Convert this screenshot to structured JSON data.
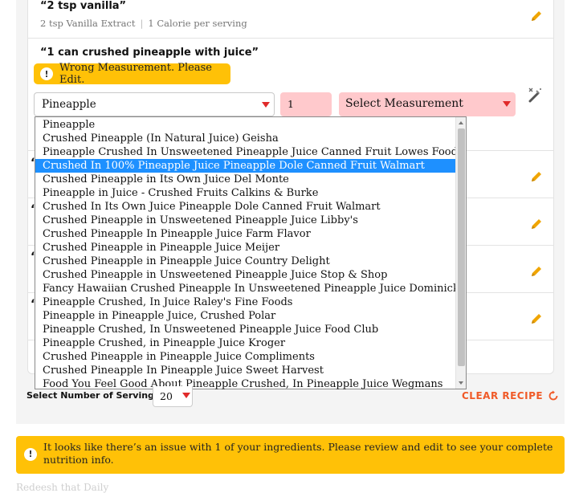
{
  "ingredients": [
    {
      "title": "“2 tsp vanilla”",
      "detail": "2 tsp Vanilla Extract",
      "calories": "1 Calorie per serving"
    },
    {
      "title": "“1 can crushed pineapple with juice”",
      "warning": "Wrong Measurement. Please Edit."
    }
  ],
  "editor": {
    "selected_food": "Pineapple",
    "quantity": "1",
    "measurement_placeholder": "Select Measurement"
  },
  "dropdown_options": [
    "Pineapple",
    "Crushed Pineapple (In Natural Juice) Geisha",
    "Pineapple Crushed In Unsweetened Pineapple Juice Canned Fruit Lowes Foods",
    "Crushed In 100% Pineapple Juice Pineapple Dole Canned Fruit Walmart",
    "Crushed Pineapple in Its Own Juice Del Monte",
    "Pineapple in Juice - Crushed Fruits Calkins & Burke",
    "Crushed In Its Own Juice Pineapple Dole Canned Fruit Walmart",
    "Crushed Pineapple in Unsweetened Pineapple Juice Libby's",
    "Crushed Pineapple In Pineapple Juice Farm Flavor",
    "Crushed Pineapple in Pineapple Juice Meijer",
    "Crushed Pineapple in Pineapple Juice Country Delight",
    "Crushed Pineapple in Unsweetened Pineapple Juice Stop & Shop",
    "Fancy Hawaiian Crushed Pineapple In Unsweetened Pineapple Juice Dominick's",
    "Pineapple Crushed, In Juice Raley's Fine Foods",
    "Pineapple in Pineapple Juice, Crushed Polar",
    "Pineapple Crushed, In Unsweetened Pineapple Juice Food Club",
    "Pineapple Crushed, in Pineapple Juice Kroger",
    "Crushed Pineapple in Pineapple Juice Compliments",
    "Crushed Pineapple In Pineapple Juice Sweet Harvest",
    "Food You Feel Good About Pineapple Crushed, In Pineapple Juice Wegmans"
  ],
  "selected_option_index": 3,
  "hidden_row_quote": "“",
  "servings": {
    "label": "Select Number of Servings:",
    "value": "20"
  },
  "clear_recipe": "CLEAR RECIPE",
  "notice": "It looks like there’s an issue with 1 of your ingredients. Please review and edit to see your complete nutrition info.",
  "footer_faded": "Redeesh that Daily",
  "colors": {
    "accent": "#f05a28",
    "warning": "#ffc107",
    "error_bg": "#ffc9cc",
    "selected": "#1e90ff"
  },
  "icons": [
    "pencil-icon",
    "warning-icon",
    "magic-wand-icon",
    "refresh-icon",
    "caret-down-icon"
  ]
}
